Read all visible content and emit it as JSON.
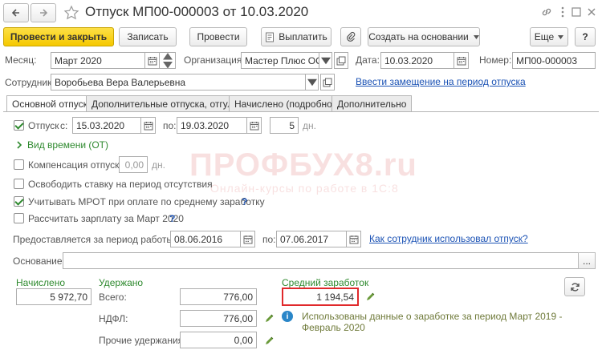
{
  "window": {
    "title": "Отпуск МП00-000003 от 10.03.2020"
  },
  "toolbar": {
    "post_close": "Провести и закрыть",
    "save": "Записать",
    "post": "Провести",
    "pay": "Выплатить",
    "create_based": "Создать на основании",
    "more": "Еще",
    "help": "?"
  },
  "header": {
    "month_label": "Месяц:",
    "month_value": "Март 2020",
    "org_label": "Организация:",
    "org_value": "Мастер Плюс ООС",
    "date_label": "Дата:",
    "date_value": "10.03.2020",
    "number_label": "Номер:",
    "number_value": "МП00-000003",
    "employee_label": "Сотрудник:",
    "employee_value": "Воробьева Вера Валерьевна",
    "replacement_link": "Ввести замещение на период отпуска"
  },
  "tabs": [
    "Основной отпуск",
    "Дополнительные отпуска, отгулы",
    "Начислено (подробно)",
    "Дополнительно"
  ],
  "vacation": {
    "label": "Отпуск",
    "from_label": "с:",
    "from_value": "15.03.2020",
    "to_label": "по:",
    "to_value": "19.03.2020",
    "days_value": "5",
    "days_unit": "дн.",
    "time_type": "Вид времени (ОТ)",
    "compensation_label": "Компенсация отпуска",
    "compensation_value": "0,00",
    "compensation_unit": "дн.",
    "free_rate_label": "Освободить ставку на период отсутствия",
    "mrot_label": "Учитывать МРОТ при оплате по среднему заработку",
    "calc_salary_label": "Рассчитать зарплату за Март 2020",
    "period_label": "Предоставляется за период работы с:",
    "period_from": "08.06.2016",
    "period_to_label": "по:",
    "period_to": "07.06.2017",
    "usage_link": "Как сотрудник использовал отпуск?",
    "basis_label": "Основание:",
    "basis_value": "",
    "basis_button": "..."
  },
  "totals": {
    "accrued_label": "Начислено",
    "accrued_value": "5 972,70",
    "withheld_label": "Удержано",
    "total_label": "Всего:",
    "total_value": "776,00",
    "ndfl_label": "НДФЛ:",
    "ndfl_value": "776,00",
    "other_label": "Прочие удержания:",
    "other_value": "0,00",
    "avg_label": "Средний заработок",
    "avg_value": "1 194,54",
    "info_text_1": "Использованы данные о заработке за период Март 2019 -",
    "info_text_2": "Февраль 2020"
  },
  "watermark": {
    "brand": "ПРОФБУХ8.ru",
    "tagline": "Онлайн-курсы по работе в 1С:8"
  },
  "colors": {
    "accent_yellow": "#f5c800",
    "label_green": "#2f8a2f",
    "link_blue": "#1c53b5",
    "highlight_red": "#e0292b"
  }
}
